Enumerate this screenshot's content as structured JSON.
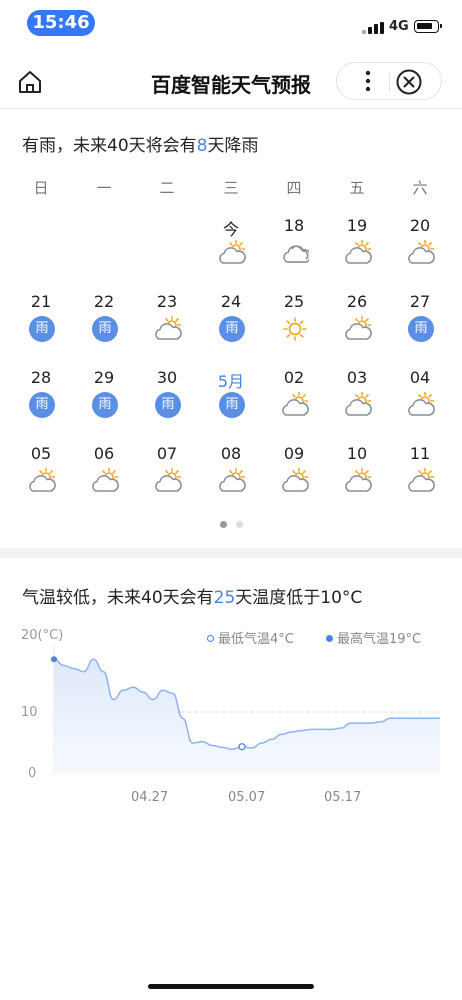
{
  "status": {
    "time": "15:46",
    "network": "4G"
  },
  "header": {
    "title": "百度智能天气预报",
    "home_icon": "home-icon",
    "more_icon": "more-dots-icon",
    "close_icon": "close-circle-icon"
  },
  "rain": {
    "summary_pre": "有雨，未来40天将会有",
    "summary_count": "8",
    "summary_post": "天降雨",
    "weekdays": [
      "日",
      "一",
      "二",
      "三",
      "四",
      "五",
      "六"
    ],
    "days": [
      {
        "label": "今",
        "icon": "partly-cloudy-icon",
        "rain_label": ""
      },
      {
        "label": "18",
        "icon": "cloudy-icon",
        "rain_label": ""
      },
      {
        "label": "19",
        "icon": "partly-cloudy-icon",
        "rain_label": ""
      },
      {
        "label": "20",
        "icon": "partly-cloudy-icon",
        "rain_label": ""
      },
      {
        "label": "21",
        "icon": "rain-icon",
        "rain_label": "雨"
      },
      {
        "label": "22",
        "icon": "rain-icon",
        "rain_label": "雨"
      },
      {
        "label": "23",
        "icon": "partly-cloudy-icon",
        "rain_label": ""
      },
      {
        "label": "24",
        "icon": "rain-icon",
        "rain_label": "雨"
      },
      {
        "label": "25",
        "icon": "sunny-icon",
        "rain_label": ""
      },
      {
        "label": "26",
        "icon": "partly-cloudy-icon",
        "rain_label": ""
      },
      {
        "label": "27",
        "icon": "rain-icon",
        "rain_label": "雨"
      },
      {
        "label": "28",
        "icon": "rain-icon",
        "rain_label": "雨"
      },
      {
        "label": "29",
        "icon": "rain-icon",
        "rain_label": "雨"
      },
      {
        "label": "30",
        "icon": "rain-icon",
        "rain_label": "雨"
      },
      {
        "label": "5月",
        "icon": "rain-icon",
        "rain_label": "雨"
      },
      {
        "label": "02",
        "icon": "partly-cloudy-icon",
        "rain_label": ""
      },
      {
        "label": "03",
        "icon": "partly-cloudy-icon",
        "rain_label": ""
      },
      {
        "label": "04",
        "icon": "partly-cloudy-icon",
        "rain_label": ""
      },
      {
        "label": "05",
        "icon": "partly-cloudy-icon",
        "rain_label": ""
      },
      {
        "label": "06",
        "icon": "partly-cloudy-icon",
        "rain_label": ""
      },
      {
        "label": "07",
        "icon": "partly-cloudy-icon",
        "rain_label": ""
      },
      {
        "label": "08",
        "icon": "partly-cloudy-icon",
        "rain_label": ""
      },
      {
        "label": "09",
        "icon": "partly-cloudy-icon",
        "rain_label": ""
      },
      {
        "label": "10",
        "icon": "partly-cloudy-icon",
        "rain_label": ""
      },
      {
        "label": "11",
        "icon": "partly-cloudy-icon",
        "rain_label": ""
      }
    ],
    "pager": {
      "count": 2,
      "active": 0
    }
  },
  "temperature": {
    "summary_pre": "气温较低，未来40天会有",
    "summary_count": "25",
    "summary_post": "天温度低于10°C",
    "legend_min": "最低气温4°C",
    "legend_max": "最高气温19°C"
  },
  "colors": {
    "accent": "#4a84e2",
    "rain_badge": "#5b8fe6",
    "sun": "#f5a623",
    "cloud": "#8a8f99",
    "line": "#8fb3ef"
  },
  "chart_data": {
    "type": "area",
    "ylabel": "20(°C)",
    "yticks": [
      "10",
      "0"
    ],
    "ylim": [
      0,
      20
    ],
    "x_ticks": [
      "04.27",
      "05.07",
      "05.17"
    ],
    "reference_line": 10,
    "grid": false,
    "legend_placement": "top-right",
    "series": [
      {
        "name": "",
        "x": [
          "04.17",
          "04.18",
          "04.19",
          "04.20",
          "04.21",
          "04.22",
          "04.23",
          "04.24",
          "04.25",
          "04.26",
          "04.27",
          "04.28",
          "04.29",
          "04.30",
          "05.01",
          "05.02",
          "05.03",
          "05.04",
          "05.05",
          "05.06",
          "05.07",
          "05.08",
          "05.09",
          "05.10",
          "05.11",
          "05.12",
          "05.13",
          "05.14",
          "05.15",
          "05.16",
          "05.17",
          "05.18",
          "05.19",
          "05.20",
          "05.21",
          "05.22",
          "05.23",
          "05.24",
          "05.25",
          "05.26"
        ],
        "values": [
          18.5,
          17.5,
          17,
          16.5,
          18.5,
          16.5,
          12,
          13.5,
          14,
          13.2,
          12,
          13.5,
          13,
          9,
          5,
          5.2,
          4.6,
          4.3,
          4,
          4.4,
          4.2,
          5,
          5.6,
          6.4,
          6.8,
          7,
          7.2,
          7.2,
          7.2,
          7.4,
          8.2,
          8.2,
          8.2,
          8.4,
          9,
          9,
          9,
          9,
          9,
          9
        ]
      }
    ],
    "markers": [
      {
        "series": "最高气温",
        "x": "04.17",
        "value": 19
      },
      {
        "series": "最低气温",
        "x": "05.06",
        "value": 4
      }
    ]
  }
}
